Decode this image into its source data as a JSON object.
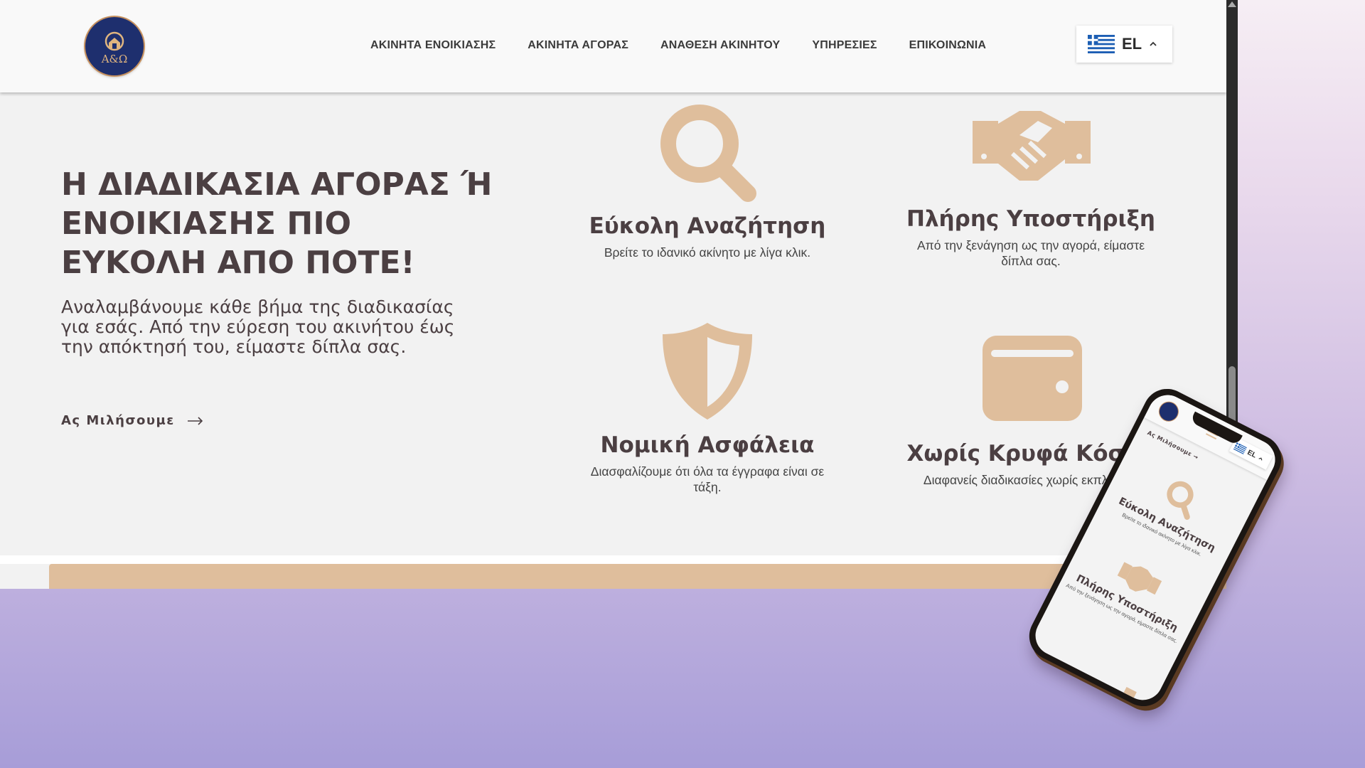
{
  "nav": {
    "items": [
      {
        "label": "ΑΚΙΝΗΤΑ ΕΝΟΙΚΙΑΣΗΣ"
      },
      {
        "label": "ΑΚΙΝΗΤΑ ΑΓΟΡΑΣ"
      },
      {
        "label": "ΑΝΑΘΕΣΗ ΑΚΙΝΗΤΟΥ"
      },
      {
        "label": "ΥΠΗΡΕΣΙΕΣ"
      },
      {
        "label": "ΕΠΙΚΟΙΝΩΝΙΑ"
      }
    ]
  },
  "language": {
    "code": "EL",
    "flag_icon": "greek-flag-icon"
  },
  "logo": {
    "text": "Α&Ω",
    "icon": "house-logo-icon"
  },
  "hero": {
    "title": "Η ΔΙΑΔΙΚΑΣΙΑ ΑΓΟΡΑΣ Ή ΕΝΟΙΚΙΑΣΗΣ ΠΙΟ ΕΥΚΟΛΗ ΑΠΟ ΠΟΤΕ!",
    "subtitle": "Αναλαμβάνουμε κάθε βήμα της διαδικασίας για εσάς. Από την εύρεση του ακινήτου έως την απόκτησή του, είμαστε δίπλα σας.",
    "cta_label": "Ας Μιλήσουμε"
  },
  "features": [
    {
      "icon": "search-icon",
      "title": "Εύκολη Αναζήτηση",
      "desc": "Βρείτε το ιδανικό ακίνητο με λίγα κλικ."
    },
    {
      "icon": "handshake-icon",
      "title": "Πλήρης Υποστήριξη",
      "desc": "Από την ξενάγηση ως την αγορά, είμαστε δίπλα σας."
    },
    {
      "icon": "shield-icon",
      "title": "Νομική Ασφάλεια",
      "desc": "Διασφαλίζουμε ότι όλα τα έγγραφα είναι σε τάξη."
    },
    {
      "icon": "wallet-icon",
      "title": "Χωρίς Κρυφά Κόστη",
      "desc": "Διαφανείς διαδικασίες χωρίς εκπλήξεις."
    }
  ],
  "phone": {
    "lang_code": "EL",
    "cta_label": "Ας Μιλήσουμε",
    "feature1_title": "Εύκολη Αναζήτηση",
    "feature1_desc": "Βρείτε το ιδανικό ακίνητο με λίγα κλικ.",
    "feature2_title": "Πλήρης Υποστήριξη",
    "feature2_desc": "Από την ξενάγηση ως την αγορά, είμαστε δίπλα σας."
  },
  "colors": {
    "accent": "#dfbe9c",
    "heading": "#4b3f42",
    "logo_bg": "#1e2f6e",
    "page_bg": "#f2f2f2"
  }
}
